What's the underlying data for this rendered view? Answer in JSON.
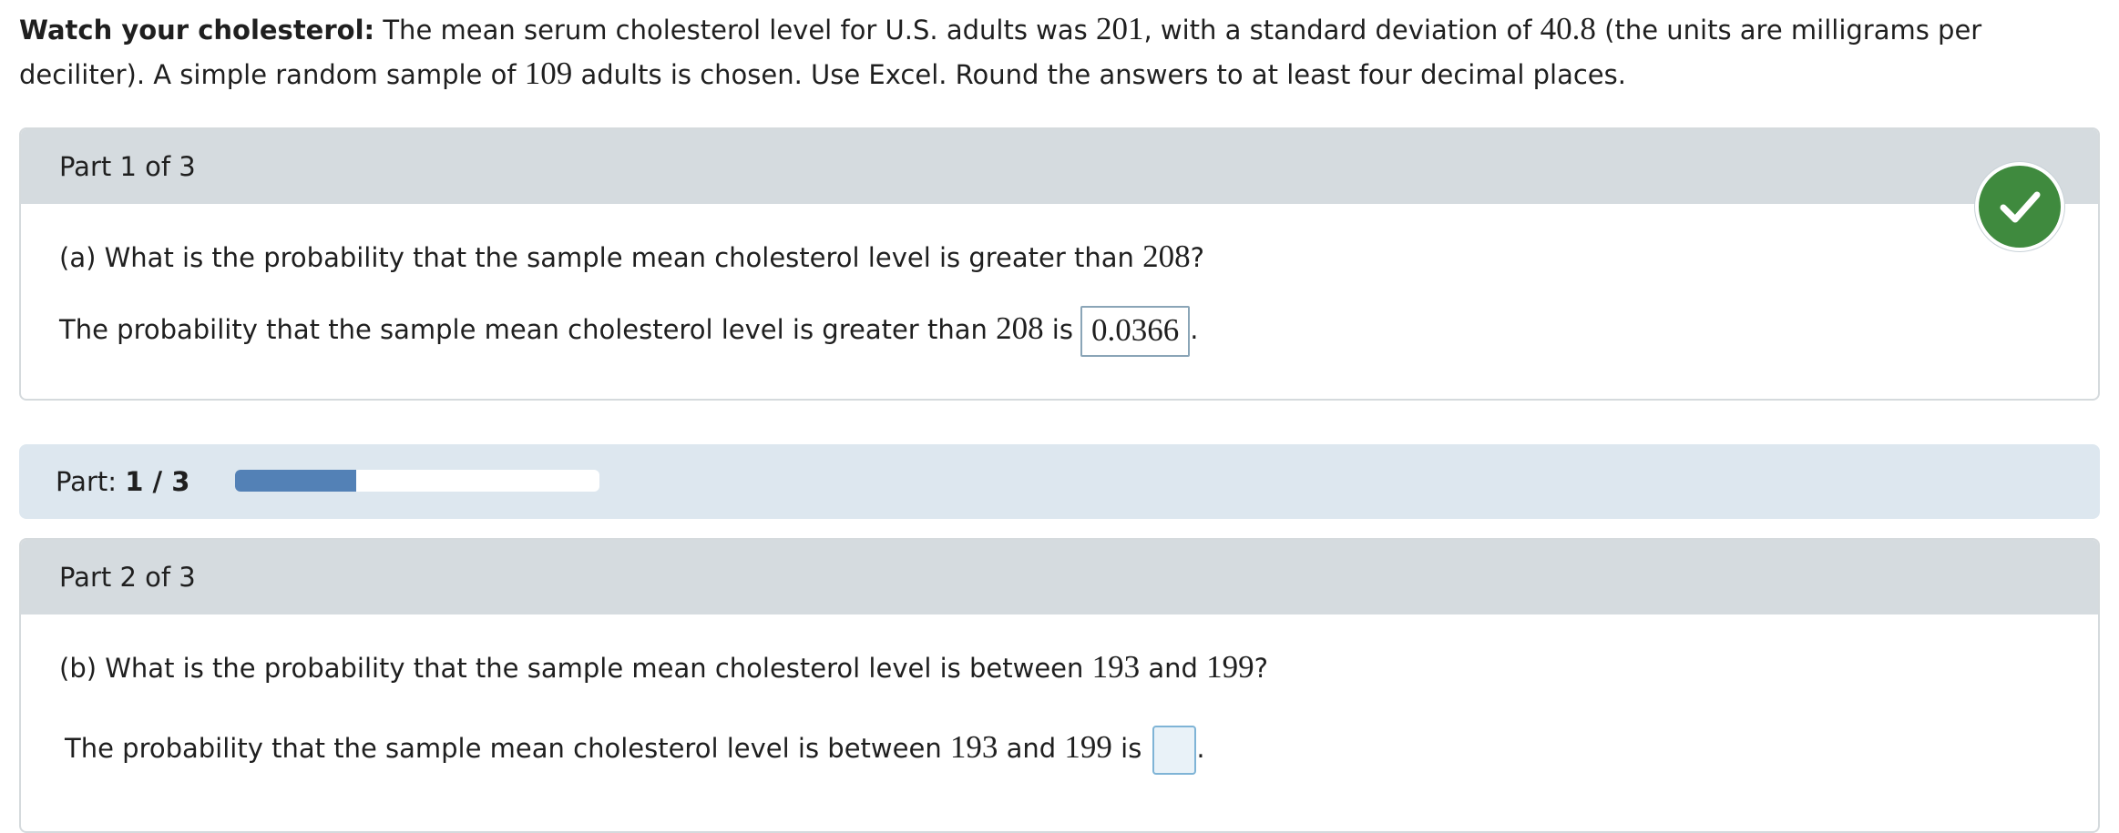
{
  "intro": {
    "bold_title": "Watch your cholesterol:",
    "t1": " The mean serum cholesterol level for U.S. adults was ",
    "mean": "201",
    "t2": ", with a standard deviation of ",
    "sd": "40.8",
    "t3": " (the units are milligrams per deciliter). A simple random sample of ",
    "n": "109",
    "t4": " adults is chosen. Use Excel. Round the answers to at least four decimal places."
  },
  "part1": {
    "header": "Part 1 of 3",
    "question_prefix": "(a) What is the probability that the sample mean cholesterol level is greater than ",
    "question_value": "208",
    "question_suffix": "?",
    "answer_prefix": "The probability that the sample mean cholesterol level is greater than ",
    "answer_value_num": "208",
    "answer_is": " is",
    "answer": "0.0366",
    "period": ".",
    "status_icon": "check-icon",
    "status_color": "#3f8a3e"
  },
  "progress": {
    "label": "Part: ",
    "current": "1 / 3",
    "fraction": 0.333,
    "fill_color": "#5381b6"
  },
  "part2": {
    "header": "Part 2 of 3",
    "question_prefix": "(b) What is the probability that the sample mean cholesterol level is between ",
    "v1": "193",
    "and": " and ",
    "v2": "199",
    "question_suffix": "?",
    "answer_prefix": "The probability that the sample mean cholesterol level is between ",
    "answer_v1": "193",
    "answer_and": " and ",
    "answer_v2": "199",
    "answer_is": " is",
    "answer_value": "",
    "period": "."
  }
}
